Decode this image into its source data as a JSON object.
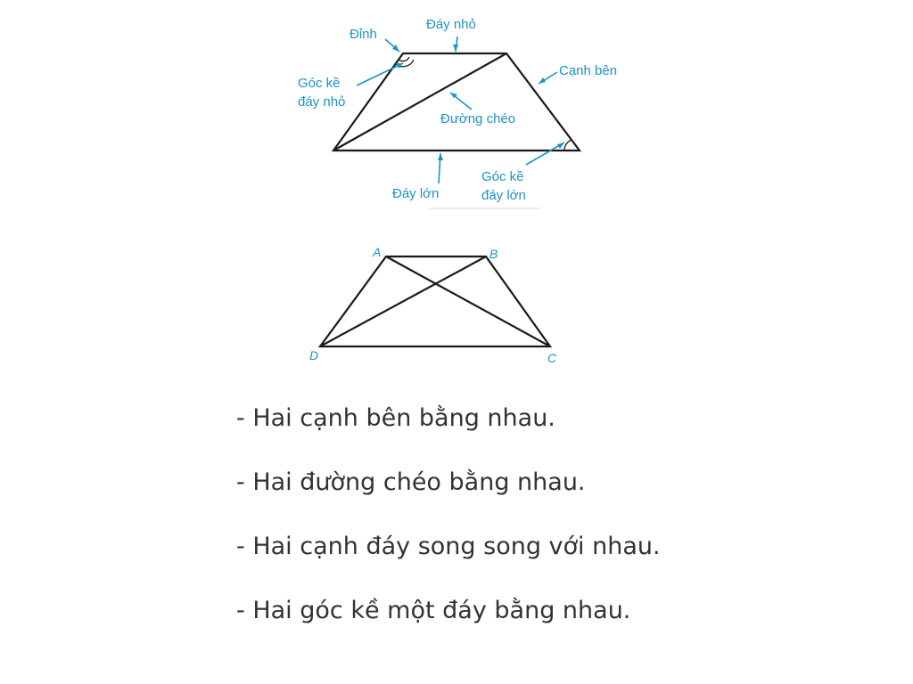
{
  "diagram1": {
    "labels": {
      "dinh": "Đỉnh",
      "day_nho": "Đáy nhỏ",
      "canh_ben": "Cạnh bên",
      "goc_ke_day_nho_1": "Góc kề",
      "goc_ke_day_nho_2": "đáy nhỏ",
      "duong_cheo": "Đường chéo",
      "day_lon": "Đáy lớn",
      "goc_ke_day_lon_1": "Góc kề",
      "goc_ke_day_lon_2": "đáy lớn"
    },
    "colors": {
      "shape": "#1a1a1a",
      "label": "#1b93c8"
    }
  },
  "diagram2": {
    "vertices": {
      "A": "A",
      "B": "B",
      "C": "C",
      "D": "D"
    }
  },
  "properties": [
    "Hai cạnh bên bằng nhau.",
    "Hai đường chéo bằng nhau.",
    "Hai cạnh đáy song song với nhau.",
    "Hai góc kề một đáy bằng nhau."
  ]
}
